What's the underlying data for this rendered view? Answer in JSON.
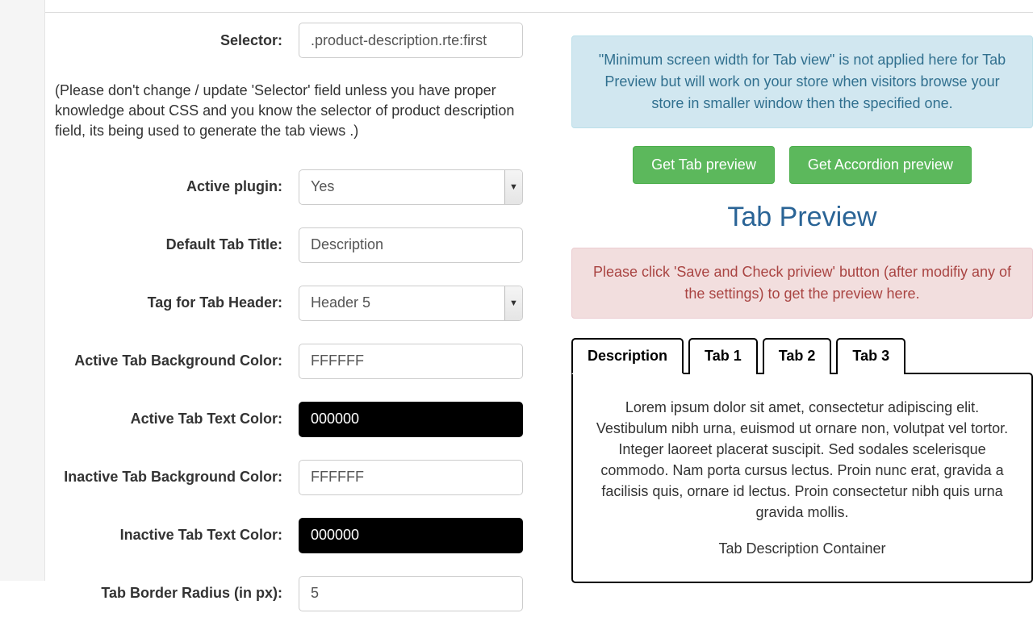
{
  "form": {
    "selector": {
      "label": "Selector:",
      "value": ".product-description.rte:first"
    },
    "help": "(Please don't change / update 'Selector' field unless you have proper knowledge about CSS and you know the selector of product description field, its being used to generate the tab views .)",
    "active_plugin": {
      "label": "Active plugin:",
      "value": "Yes"
    },
    "default_tab_title": {
      "label": "Default Tab Title:",
      "value": "Description"
    },
    "tag_tab_header": {
      "label": "Tag for Tab Header:",
      "value": "Header 5"
    },
    "active_bg": {
      "label": "Active Tab Background Color:",
      "value": "FFFFFF"
    },
    "active_text": {
      "label": "Active Tab Text Color:",
      "value": "000000"
    },
    "inactive_bg": {
      "label": "Inactive Tab Background Color:",
      "value": "FFFFFF"
    },
    "inactive_text": {
      "label": "Inactive Tab Text Color:",
      "value": "000000"
    },
    "border_radius": {
      "label": "Tab Border Radius (in px):",
      "value": "5"
    }
  },
  "right": {
    "info_alert": "\"Minimum screen width for Tab view\" is not applied here for Tab Preview but will work on your store when visitors browse your store in smaller window then the specified one.",
    "btn_tab": "Get Tab preview",
    "btn_accordion": "Get Accordion preview",
    "preview_title": "Tab Preview",
    "danger_alert": "Please click 'Save and Check priview' button (after modifiy any of the settings) to get the preview here.",
    "tabs": [
      "Description",
      "Tab 1",
      "Tab 2",
      "Tab 3"
    ],
    "content_p1": "Lorem ipsum dolor sit amet, consectetur adipiscing elit. Vestibulum nibh urna, euismod ut ornare non, volutpat vel tortor. Integer laoreet placerat suscipit. Sed sodales scelerisque commodo. Nam porta cursus lectus. Proin nunc erat, gravida a facilisis quis, ornare id lectus. Proin consectetur nibh quis urna gravida mollis.",
    "content_p2": "Tab Description Container"
  }
}
